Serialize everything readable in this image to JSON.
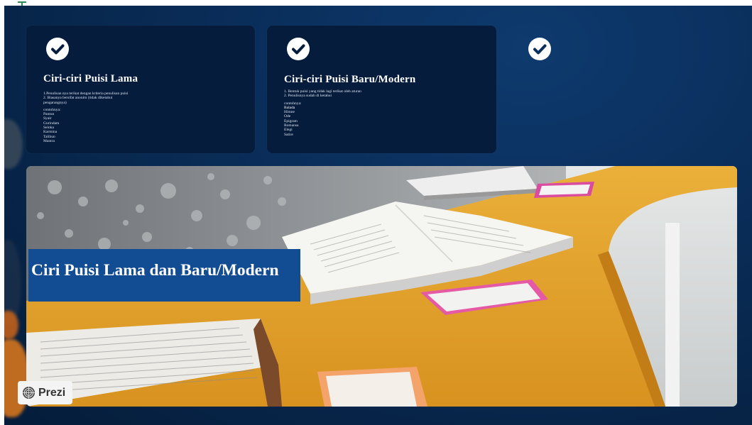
{
  "card_left": {
    "title": "Ciri-ciri Puisi Lama",
    "line1": "1.Penulisan nya terikat dengan kriteria penulisan puisi",
    "line2": "2. Biasanya bersifat anonim (tidak diketahui",
    "line3": "pengarangnya)",
    "example_label": "contohnya:",
    "examples": [
      "Pantun",
      "Syair",
      "Gurindam",
      "Seloka",
      "Karmina",
      "Talibun",
      "Mantra"
    ]
  },
  "card_middle": {
    "title": "Ciri-ciri Puisi Baru/Modern",
    "line1": "1.  Bentuk puisi yang tidak lagi terikat oleh aturan",
    "line2": "2. Penulisnya sudah di ketahui",
    "example_label": "contohnya:",
    "examples": [
      "Balada",
      "Himne",
      "Ode",
      "Epigram",
      "Romansa",
      "Elegi",
      "Satire"
    ]
  },
  "hero": {
    "title": "Ciri Puisi Lama dan Baru/Modern"
  },
  "badge": {
    "label": "Prezi"
  },
  "colors": {
    "background": "#0a2f5c",
    "card": "#061c3d",
    "title_box": "#124c92",
    "table": "#e3a52b"
  },
  "icons": [
    "check-circle-icon",
    "check-circle-icon",
    "check-circle-icon",
    "prezi-logo-icon"
  ]
}
